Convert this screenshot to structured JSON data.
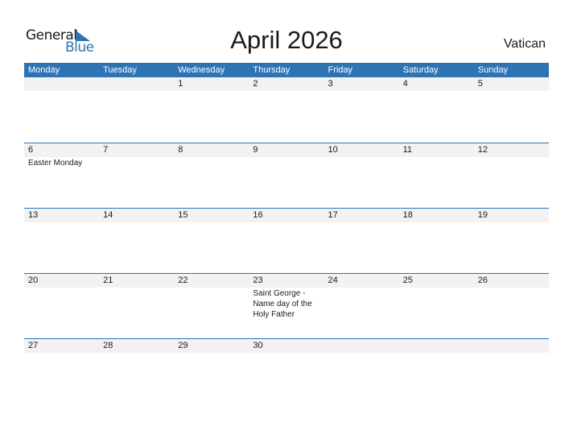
{
  "logo": {
    "word1": "General",
    "word2": "Blue"
  },
  "title": "April 2026",
  "country": "Vatican",
  "colors": {
    "accent": "#2e74b5",
    "band": "#f2f2f2"
  },
  "weekdays": [
    "Monday",
    "Tuesday",
    "Wednesday",
    "Thursday",
    "Friday",
    "Saturday",
    "Sunday"
  ],
  "weeks": [
    {
      "days": [
        {
          "num": "",
          "event": ""
        },
        {
          "num": "",
          "event": ""
        },
        {
          "num": "1",
          "event": ""
        },
        {
          "num": "2",
          "event": ""
        },
        {
          "num": "3",
          "event": ""
        },
        {
          "num": "4",
          "event": ""
        },
        {
          "num": "5",
          "event": ""
        }
      ]
    },
    {
      "days": [
        {
          "num": "6",
          "event": "Easter Monday"
        },
        {
          "num": "7",
          "event": ""
        },
        {
          "num": "8",
          "event": ""
        },
        {
          "num": "9",
          "event": ""
        },
        {
          "num": "10",
          "event": ""
        },
        {
          "num": "11",
          "event": ""
        },
        {
          "num": "12",
          "event": ""
        }
      ]
    },
    {
      "days": [
        {
          "num": "13",
          "event": ""
        },
        {
          "num": "14",
          "event": ""
        },
        {
          "num": "15",
          "event": ""
        },
        {
          "num": "16",
          "event": ""
        },
        {
          "num": "17",
          "event": ""
        },
        {
          "num": "18",
          "event": ""
        },
        {
          "num": "19",
          "event": ""
        }
      ]
    },
    {
      "days": [
        {
          "num": "20",
          "event": ""
        },
        {
          "num": "21",
          "event": ""
        },
        {
          "num": "22",
          "event": ""
        },
        {
          "num": "23",
          "event": "Saint George - Name day of the Holy Father"
        },
        {
          "num": "24",
          "event": ""
        },
        {
          "num": "25",
          "event": ""
        },
        {
          "num": "26",
          "event": ""
        }
      ]
    },
    {
      "days": [
        {
          "num": "27",
          "event": ""
        },
        {
          "num": "28",
          "event": ""
        },
        {
          "num": "29",
          "event": ""
        },
        {
          "num": "30",
          "event": ""
        },
        {
          "num": "",
          "event": ""
        },
        {
          "num": "",
          "event": ""
        },
        {
          "num": "",
          "event": ""
        }
      ]
    }
  ]
}
